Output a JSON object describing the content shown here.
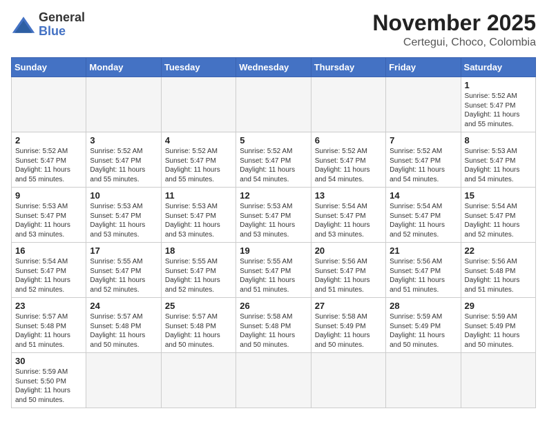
{
  "header": {
    "logo_general": "General",
    "logo_blue": "Blue",
    "month_year": "November 2025",
    "location": "Certegui, Choco, Colombia"
  },
  "weekdays": [
    "Sunday",
    "Monday",
    "Tuesday",
    "Wednesday",
    "Thursday",
    "Friday",
    "Saturday"
  ],
  "days": {
    "1": {
      "sunrise": "Sunrise: 5:52 AM",
      "sunset": "Sunset: 5:47 PM",
      "daylight": "Daylight: 11 hours and 55 minutes."
    },
    "2": {
      "sunrise": "Sunrise: 5:52 AM",
      "sunset": "Sunset: 5:47 PM",
      "daylight": "Daylight: 11 hours and 55 minutes."
    },
    "3": {
      "sunrise": "Sunrise: 5:52 AM",
      "sunset": "Sunset: 5:47 PM",
      "daylight": "Daylight: 11 hours and 55 minutes."
    },
    "4": {
      "sunrise": "Sunrise: 5:52 AM",
      "sunset": "Sunset: 5:47 PM",
      "daylight": "Daylight: 11 hours and 55 minutes."
    },
    "5": {
      "sunrise": "Sunrise: 5:52 AM",
      "sunset": "Sunset: 5:47 PM",
      "daylight": "Daylight: 11 hours and 54 minutes."
    },
    "6": {
      "sunrise": "Sunrise: 5:52 AM",
      "sunset": "Sunset: 5:47 PM",
      "daylight": "Daylight: 11 hours and 54 minutes."
    },
    "7": {
      "sunrise": "Sunrise: 5:52 AM",
      "sunset": "Sunset: 5:47 PM",
      "daylight": "Daylight: 11 hours and 54 minutes."
    },
    "8": {
      "sunrise": "Sunrise: 5:53 AM",
      "sunset": "Sunset: 5:47 PM",
      "daylight": "Daylight: 11 hours and 54 minutes."
    },
    "9": {
      "sunrise": "Sunrise: 5:53 AM",
      "sunset": "Sunset: 5:47 PM",
      "daylight": "Daylight: 11 hours and 53 minutes."
    },
    "10": {
      "sunrise": "Sunrise: 5:53 AM",
      "sunset": "Sunset: 5:47 PM",
      "daylight": "Daylight: 11 hours and 53 minutes."
    },
    "11": {
      "sunrise": "Sunrise: 5:53 AM",
      "sunset": "Sunset: 5:47 PM",
      "daylight": "Daylight: 11 hours and 53 minutes."
    },
    "12": {
      "sunrise": "Sunrise: 5:53 AM",
      "sunset": "Sunset: 5:47 PM",
      "daylight": "Daylight: 11 hours and 53 minutes."
    },
    "13": {
      "sunrise": "Sunrise: 5:54 AM",
      "sunset": "Sunset: 5:47 PM",
      "daylight": "Daylight: 11 hours and 53 minutes."
    },
    "14": {
      "sunrise": "Sunrise: 5:54 AM",
      "sunset": "Sunset: 5:47 PM",
      "daylight": "Daylight: 11 hours and 52 minutes."
    },
    "15": {
      "sunrise": "Sunrise: 5:54 AM",
      "sunset": "Sunset: 5:47 PM",
      "daylight": "Daylight: 11 hours and 52 minutes."
    },
    "16": {
      "sunrise": "Sunrise: 5:54 AM",
      "sunset": "Sunset: 5:47 PM",
      "daylight": "Daylight: 11 hours and 52 minutes."
    },
    "17": {
      "sunrise": "Sunrise: 5:55 AM",
      "sunset": "Sunset: 5:47 PM",
      "daylight": "Daylight: 11 hours and 52 minutes."
    },
    "18": {
      "sunrise": "Sunrise: 5:55 AM",
      "sunset": "Sunset: 5:47 PM",
      "daylight": "Daylight: 11 hours and 52 minutes."
    },
    "19": {
      "sunrise": "Sunrise: 5:55 AM",
      "sunset": "Sunset: 5:47 PM",
      "daylight": "Daylight: 11 hours and 51 minutes."
    },
    "20": {
      "sunrise": "Sunrise: 5:56 AM",
      "sunset": "Sunset: 5:47 PM",
      "daylight": "Daylight: 11 hours and 51 minutes."
    },
    "21": {
      "sunrise": "Sunrise: 5:56 AM",
      "sunset": "Sunset: 5:47 PM",
      "daylight": "Daylight: 11 hours and 51 minutes."
    },
    "22": {
      "sunrise": "Sunrise: 5:56 AM",
      "sunset": "Sunset: 5:48 PM",
      "daylight": "Daylight: 11 hours and 51 minutes."
    },
    "23": {
      "sunrise": "Sunrise: 5:57 AM",
      "sunset": "Sunset: 5:48 PM",
      "daylight": "Daylight: 11 hours and 51 minutes."
    },
    "24": {
      "sunrise": "Sunrise: 5:57 AM",
      "sunset": "Sunset: 5:48 PM",
      "daylight": "Daylight: 11 hours and 50 minutes."
    },
    "25": {
      "sunrise": "Sunrise: 5:57 AM",
      "sunset": "Sunset: 5:48 PM",
      "daylight": "Daylight: 11 hours and 50 minutes."
    },
    "26": {
      "sunrise": "Sunrise: 5:58 AM",
      "sunset": "Sunset: 5:48 PM",
      "daylight": "Daylight: 11 hours and 50 minutes."
    },
    "27": {
      "sunrise": "Sunrise: 5:58 AM",
      "sunset": "Sunset: 5:49 PM",
      "daylight": "Daylight: 11 hours and 50 minutes."
    },
    "28": {
      "sunrise": "Sunrise: 5:59 AM",
      "sunset": "Sunset: 5:49 PM",
      "daylight": "Daylight: 11 hours and 50 minutes."
    },
    "29": {
      "sunrise": "Sunrise: 5:59 AM",
      "sunset": "Sunset: 5:49 PM",
      "daylight": "Daylight: 11 hours and 50 minutes."
    },
    "30": {
      "sunrise": "Sunrise: 5:59 AM",
      "sunset": "Sunset: 5:50 PM",
      "daylight": "Daylight: 11 hours and 50 minutes."
    }
  }
}
